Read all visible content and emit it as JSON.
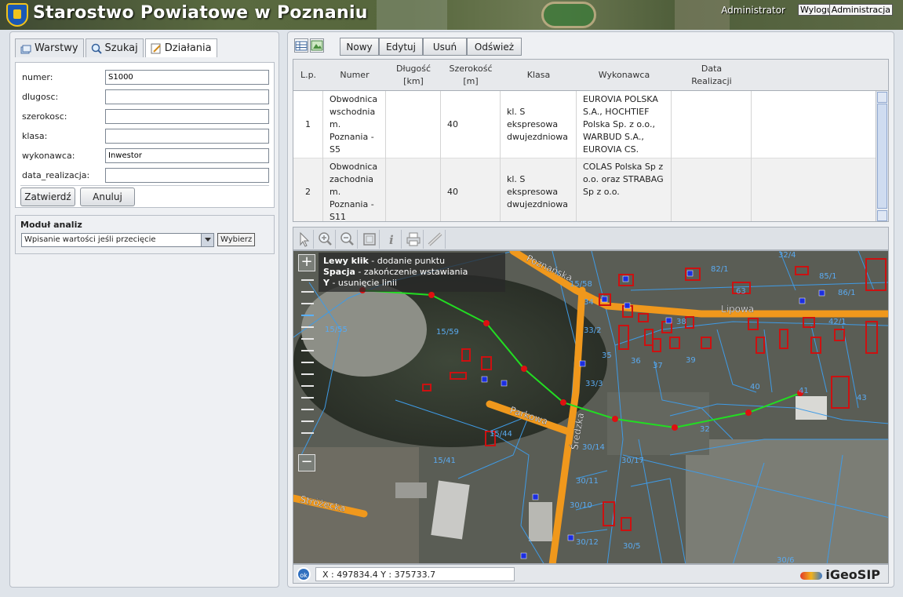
{
  "header": {
    "title": "Starostwo Powiatowe w Poznaniu",
    "user": "Administrator",
    "logout": "Wyloguj",
    "admin": "Administracja"
  },
  "left": {
    "tabs": [
      "Warstwy",
      "Szukaj",
      "Działania"
    ],
    "active_tab": "Działania",
    "fields": [
      {
        "label": "numer:",
        "value": "S1000"
      },
      {
        "label": "dlugosc:",
        "value": ""
      },
      {
        "label": "szerokosc:",
        "value": ""
      },
      {
        "label": "klasa:",
        "value": ""
      },
      {
        "label": "wykonawca:",
        "value": "Inwestor"
      },
      {
        "label": "data_realizacja:",
        "value": ""
      }
    ],
    "confirm": "Zatwierdź",
    "cancel": "Anuluj",
    "analysis": {
      "title": "Moduł analiz",
      "selected": "Wpisanie wartości jeśli przecięcie",
      "button": "Wybierz"
    }
  },
  "toolbar": {
    "buttons": [
      "Nowy",
      "Edytuj",
      "Usuń",
      "Odśwież"
    ]
  },
  "table": {
    "headers": [
      "L.p.",
      "Numer",
      "Długość\n[km]",
      "Szerokość\n[m]",
      "Klasa",
      "Wykonawca",
      "Data\nRealizacji"
    ],
    "rows": [
      {
        "lp": "1",
        "numer": "Obwodnica wschodnia m. Poznania - S5",
        "dlugosc": "",
        "szerokosc": "40",
        "klasa": "kl. S ekspresowa dwujezdniowa",
        "wykonawca": "EUROVIA POLSKA S.A., HOCHTIEF Polska Sp. z o.o., WARBUD S.A., EUROVIA CS.",
        "data": ""
      },
      {
        "lp": "2",
        "numer": "Obwodnica zachodnia m. Poznania - S11",
        "dlugosc": "",
        "szerokosc": "40",
        "klasa": "kl. S ekspresowa dwujezdniowa",
        "wykonawca": "COLAS Polska Sp z o.o. oraz STRABAG Sp z o.o.",
        "data": ""
      }
    ]
  },
  "map": {
    "hint": [
      {
        "key": "Lewy klik",
        "text": " - dodanie punktu"
      },
      {
        "key": "Spacja",
        "text": " - zakończenie wstawiania"
      },
      {
        "key": "Y",
        "text": " - usunięcie linii"
      }
    ],
    "streets": [
      "Poznańska",
      "Lipowa",
      "Parkowa",
      "Średzka",
      "Stróżecka"
    ],
    "parcels": [
      "32/4",
      "82/1",
      "85/1",
      "86/1",
      "15/58",
      "34",
      "33/2",
      "35",
      "36",
      "37",
      "38",
      "39",
      "42/1",
      "40",
      "41",
      "43",
      "15/55",
      "15/59",
      "33/3",
      "32",
      "15/44",
      "30/14",
      "30/17",
      "15/41",
      "30/11",
      "30/10",
      "30/12",
      "30/5",
      "30/6",
      "63"
    ],
    "ok": "ok",
    "coords": "X : 497834.4 Y : 375733.7",
    "logo": "iGeoSIP",
    "colors": {
      "line": "#22dd22",
      "vertex": "#dd1111",
      "parcel": "#3f9be6",
      "building": "#cc1111",
      "road": "#f0981c"
    }
  }
}
